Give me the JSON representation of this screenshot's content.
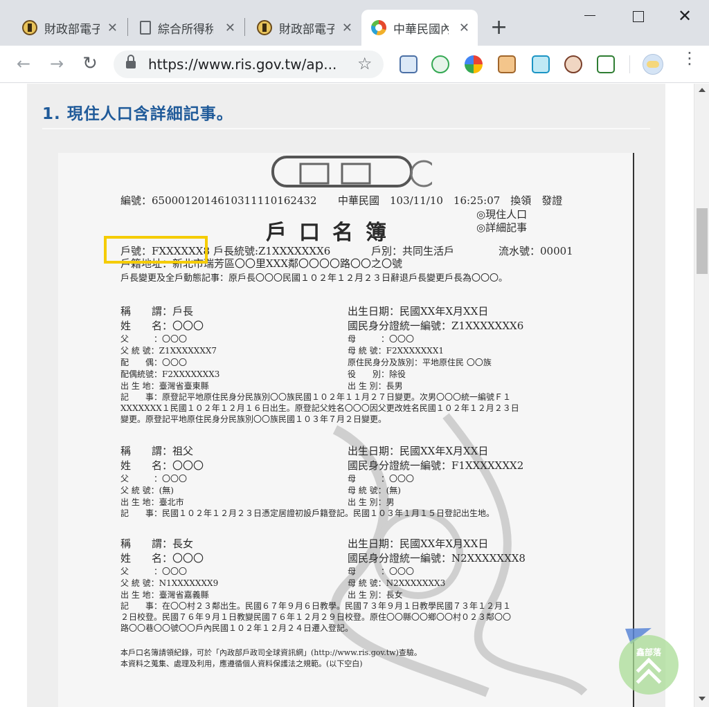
{
  "browser": {
    "tabs": [
      {
        "title": "財政部電子",
        "icon": "mof-seal-icon",
        "active": false
      },
      {
        "title": "綜合所得稅",
        "icon": "document-icon",
        "active": false
      },
      {
        "title": "財政部電子",
        "icon": "mof-seal-icon",
        "active": false
      },
      {
        "title": "中華民國內",
        "icon": "ris-logo-icon",
        "active": true
      }
    ],
    "new_tab_symbol": "+",
    "close_symbol": "✕",
    "url": "https://www.ris.gov.tw/ap...",
    "nav": {
      "back": "←",
      "forward": "→",
      "reload": "↻"
    },
    "star_symbol": "☆",
    "extensions": [
      "notes-icon",
      "mail-check-icon",
      "colorful-logo-icon",
      "box-face-icon",
      "screen-share-icon",
      "owl-icon",
      "screenshot-icon"
    ],
    "menu_symbol": "⋮"
  },
  "page": {
    "heading": "1. 現住人口含詳細記事。"
  },
  "household_register": {
    "serial": "編號：6500012014610311110162432",
    "issue_date": "中華民國　103/11/10　16:25:07　換領　發證",
    "doc_type_1": "◎現住人口",
    "doc_type_2": "◎詳細記事",
    "title": "戶口名簿",
    "household_no": "戶號：FXXXXXX8",
    "head_id": "戶長統號:Z1XXXXXXX6",
    "household_type": "戶別：共同生活戶",
    "flow_no": "流水號：00001",
    "address": "戶籍地址：新北市瑞芳區〇〇里XXX鄰〇〇〇〇路〇〇之〇號",
    "changes": "戶長變更及全戶動態記事：原戶長〇〇〇民國１０２年１２月２３日辭退戶長變更戶長為〇〇〇。",
    "members": [
      {
        "relation": "稱　　謂：戶長",
        "birth": "出生日期：民國XX年X月XX日",
        "name": "姓　　名：〇〇〇",
        "id": "國民身分證統一編號：Z1XXXXXXX6",
        "father": "父　　　：〇〇〇",
        "mother": "母　　　：〇〇〇",
        "father_id": "父 統 號：Z1XXXXXXX7",
        "mother_id": "母 統 號：F2XXXXXXX1",
        "spouse": "配　　偶：〇〇〇",
        "aboriginal": "原住民身分及族別：平地原住民 〇〇族",
        "spouse_id": "配偶統號：F2XXXXXXX3",
        "military": "役　　別：除役",
        "birthplace": "出 生 地：臺灣省臺東縣",
        "birth_order": "出 生 別：長男",
        "note_1": "記　　事：原登記平地原住民身分民族別〇〇族民國１０２年１１月２７日變更。次男〇〇〇統一編號Ｆ１",
        "note_2": "XXXXXXX１民國１０２年１２月１６日出生。原登記父姓名〇〇〇因父更改姓名民國１０２年１２月２３日",
        "note_3": "變更。原登記平地原住民身分民族別〇〇族民國１０３年７月２日變更。"
      },
      {
        "relation": "稱　　謂：祖父",
        "birth": "出生日期：民國XX年X月XX日",
        "name": "姓　　名：〇〇〇",
        "id": "國民身分證統一編號：F1XXXXXXX2",
        "father": "父　　　：〇〇〇",
        "mother": "母　　　：〇〇〇",
        "father_id": "父 統 號：(無)",
        "mother_id": "母 統 號：(無)",
        "birthplace": "出 生 地：臺北市",
        "birth_order": "出 生 別：男",
        "note_1": "記　　事：民國１０２年１２月２３日憑定居證初設戶籍登記。民國１０３年１月１５日登記出生地。"
      },
      {
        "relation": "稱　　謂：長女",
        "birth": "出生日期：民國XX年X月XX日",
        "name": "姓　　名：〇〇〇",
        "id": "國民身分證統一編號：N2XXXXXXX8",
        "father": "父　　　：〇〇〇",
        "mother": "母　　　：〇〇〇",
        "father_id": "父 統 號：N1XXXXXXX9",
        "mother_id": "母 統 號：N2XXXXXXX3",
        "birthplace": "出 生 地：臺灣省嘉義縣",
        "birth_order": "出 生 別：長女",
        "note_1": "記　　事：在〇〇村２３鄰出生。民國６７年９月６日教學。民國７３年９月１日教學民國７３年１２月１",
        "note_2": "２日校登。民國７６年９月１日教變民國７６年１２月２９日校登。原住〇〇縣〇〇鄉〇〇村０２３鄰〇〇",
        "note_3": "路〇〇巷〇〇號〇〇戶內民國１０２年１２月２４日遷入登記。"
      }
    ],
    "footer_1": "本戶口名簿請領紀錄，可於「內政部戶政司全球資訊網」(http://www.ris.gov.tw)查驗。",
    "footer_2": "本資料之蒐集、處理及利用，應遵循個人資料保護法之規範。(以下空白)"
  },
  "badge": {
    "label": "鑫部落"
  }
}
